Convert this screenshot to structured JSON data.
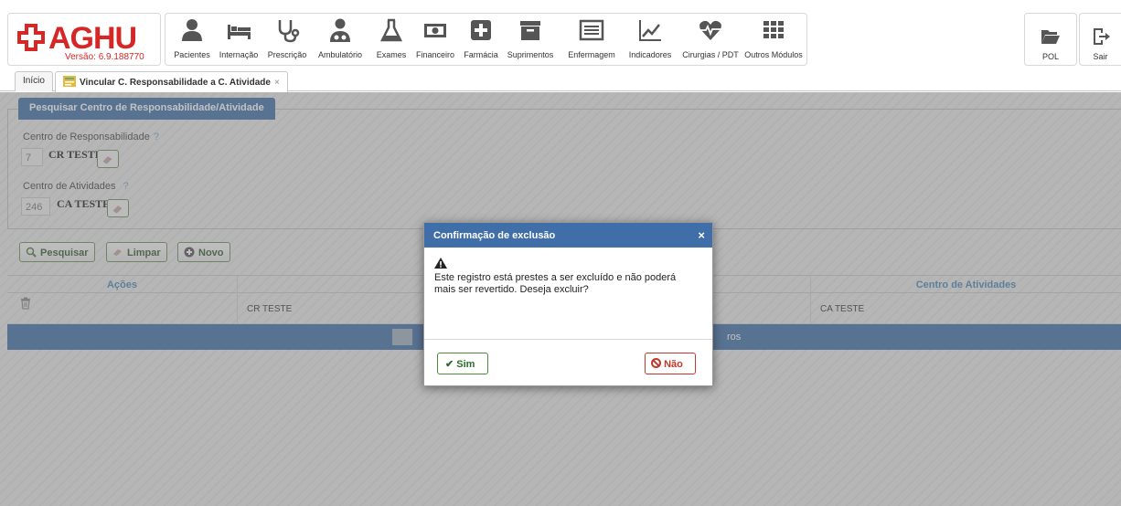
{
  "app": {
    "logo": "AGHU",
    "version": "Versão: 6.9.188770"
  },
  "modules": [
    {
      "label": "Pacientes",
      "icon": "person-icon"
    },
    {
      "label": "Internação",
      "icon": "bed-icon"
    },
    {
      "label": "Prescrição",
      "icon": "stethoscope-icon"
    },
    {
      "label": "Ambulatório",
      "icon": "doctor-icon"
    },
    {
      "label": "Exames",
      "icon": "flask-icon"
    },
    {
      "label": "Financeiro",
      "icon": "money-icon"
    },
    {
      "label": "Farmácia",
      "icon": "plus-square-icon"
    },
    {
      "label": "Suprimentos",
      "icon": "archive-icon"
    },
    {
      "label": "Enfermagem",
      "icon": "list-icon"
    },
    {
      "label": "Indicadores",
      "icon": "line-chart-icon"
    },
    {
      "label": "Cirurgias / PDT",
      "icon": "heartbeat-icon"
    },
    {
      "label": "Outros Módulos",
      "icon": "grid-icon"
    }
  ],
  "right": {
    "pol": "POL",
    "sair": "Sair"
  },
  "tabs": {
    "home": "Início",
    "active": "Vincular C. Responsabilidade a C. Atividade",
    "close": "×"
  },
  "search": {
    "legend": "Pesquisar Centro de Responsabilidade/Atividade",
    "cr_label": "Centro de Responsabilidade",
    "cr_code": "7",
    "cr_value": "CR TESTE",
    "ca_label": "Centro de Atividades",
    "ca_code": "246",
    "ca_value": "CA TESTE",
    "help": "?"
  },
  "buttons": {
    "pesquisar": "Pesquisar",
    "limpar": "Limpar",
    "novo": "Novo"
  },
  "grid": {
    "headers": [
      "Ações",
      "Centro de Atividades"
    ],
    "row": {
      "cr": "CR TESTE",
      "ca": "CA TESTE"
    },
    "pager_text": "ros"
  },
  "dialog": {
    "title": "Confirmação de exclusão",
    "close": "×",
    "message": "Este registro está prestes a ser excluído e não poderá mais ser revertido. Deseja excluir?",
    "yes": "Sim",
    "no": "Não"
  },
  "colors": {
    "brand_red": "#d62626",
    "header_blue": "#3f6ea8",
    "ok_green": "#4d8a3a",
    "danger_red": "#c0392b"
  }
}
